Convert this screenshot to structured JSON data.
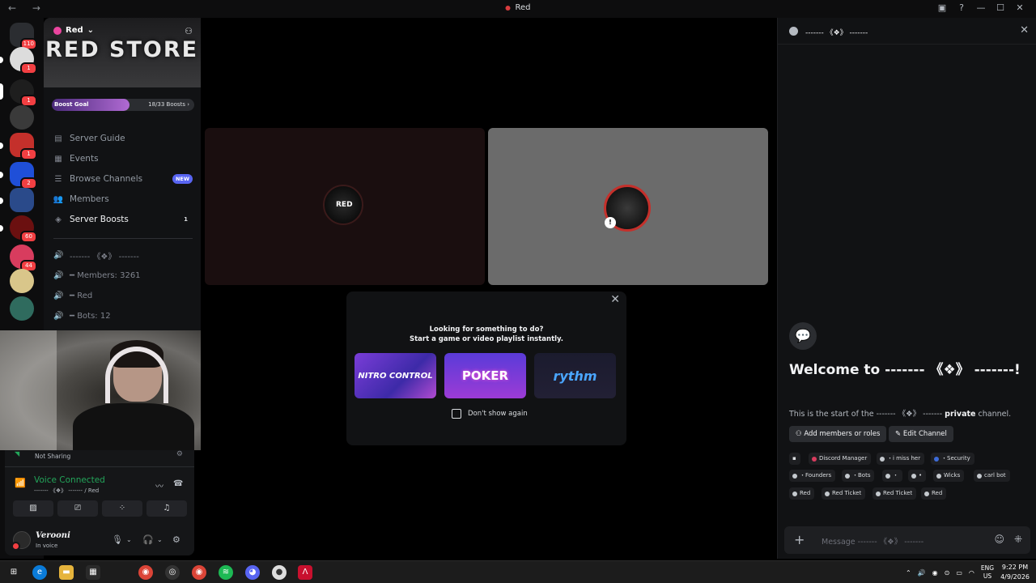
{
  "titlebar": {
    "title": "Red",
    "nav": "← →"
  },
  "rail": {
    "badges": [
      "110",
      "1",
      "1",
      "1",
      "2",
      "60",
      "44"
    ]
  },
  "server": {
    "name": "Red",
    "banner_text": "RED STORE",
    "boost_label": "Boost Goal",
    "boost_count": "18/33 Boosts",
    "boost_progress": 0.545
  },
  "nav": {
    "items": [
      {
        "label": "Server Guide",
        "icon": "signpost-icon"
      },
      {
        "label": "Events",
        "icon": "calendar-icon"
      },
      {
        "label": "Browse Channels",
        "icon": "list-icon",
        "badge": "NEW"
      },
      {
        "label": "Members",
        "icon": "members-icon"
      },
      {
        "label": "Server Boosts",
        "icon": "boost-icon",
        "count": "1"
      }
    ]
  },
  "voice_channels": [
    "------- 《❖》 -------",
    "━  Members: 3261",
    "━  Red",
    "━  Bots: 12"
  ],
  "voice": {
    "not_sharing": "Not Sharing",
    "status": "Voice Connected",
    "channel": "------- 《❖》 ------- / Red"
  },
  "user": {
    "name": "Verooni",
    "status": "In voice"
  },
  "popup": {
    "line1": "Looking for something to do?",
    "line2": "Start a game or video playlist instantly.",
    "activities": [
      "NITRO CONTROL",
      "POKER",
      "rythm"
    ],
    "checkbox_label": "Don't show again"
  },
  "chat": {
    "channel_name": "------- 《❖》 -------",
    "welcome": "Welcome to ------- 《❖》 -------!",
    "start_prefix": "This is the start of the ------- 《❖》 -------",
    "start_bold": "private",
    "start_suffix": "channel.",
    "btn_add": "Add members or roles",
    "btn_edit": "Edit Channel",
    "roles": [
      "Discord Manager",
      "・i miss her",
      "・Security",
      "・Founders",
      "・Bots",
      "・",
      "•",
      "Wicks",
      "carl bot",
      "Red",
      "Red Ticket",
      "Red Ticket",
      "Red"
    ],
    "placeholder": "Message ------- 《❖》 -------"
  },
  "taskbar": {
    "lang1": "ENG",
    "lang2": "US",
    "time": "9:22 PM",
    "date": "4/9/2026"
  },
  "colors": {
    "accent": "#5865f2",
    "voice_green": "#23a55a",
    "danger": "#f23f42"
  }
}
